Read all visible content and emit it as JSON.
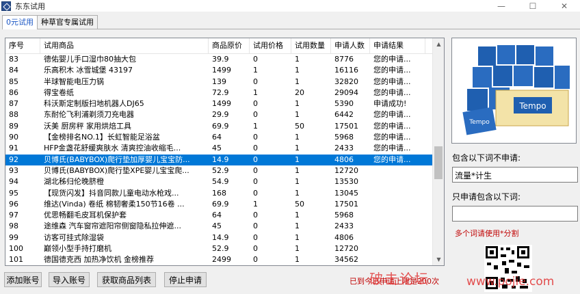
{
  "window": {
    "title": "东东试用",
    "icon": "app-logo-icon"
  },
  "tabs": [
    {
      "label": "0元试用",
      "active": true
    },
    {
      "label": "种草官专属试用",
      "active": false
    }
  ],
  "table": {
    "columns": [
      "序号",
      "试用商品",
      "商品原价",
      "试用价格",
      "试用数量",
      "申请人数",
      "申请结果"
    ],
    "rows": [
      [
        "83",
        "德佑婴儿手口湿巾80抽大包",
        "39.9",
        "0",
        "1",
        "8776",
        "您的申请..."
      ],
      [
        "84",
        "乐高积木 冰雪城堡 43197",
        "1499",
        "1",
        "1",
        "16116",
        "您的申请..."
      ],
      [
        "85",
        "半球智能电压力锅",
        "139",
        "0",
        "1",
        "32820",
        "您的申请..."
      ],
      [
        "86",
        "得宝卷纸",
        "72.9",
        "1",
        "20",
        "29094",
        "您的申请..."
      ],
      [
        "87",
        "科沃斯定制版扫地机器人DJ65",
        "1499",
        "0",
        "1",
        "5390",
        "申请成功!"
      ],
      [
        "88",
        "东耐伦飞利浦剃须刀充电器",
        "29.9",
        "0",
        "1",
        "6442",
        "您的申请..."
      ],
      [
        "89",
        "沃美 厨房秤 家用烘焙工具",
        "69.9",
        "1",
        "50",
        "17501",
        "您的申请..."
      ],
      [
        "90",
        "【金榜排名NO.1】长虹智能足浴盆",
        "64",
        "0",
        "1",
        "5968",
        "您的申请..."
      ],
      [
        "91",
        "HFP金盏花舒缓爽肤水 清爽控油收缩毛...",
        "45",
        "0",
        "1",
        "2433",
        "您的申请..."
      ],
      [
        "92",
        "贝博氏(BABYBOX)爬行垫加厚婴儿宝宝防...",
        "14.9",
        "0",
        "1",
        "4806",
        "您的申请..."
      ],
      [
        "93",
        "贝博氏(BABYBOX)爬行垫XPE婴儿宝宝爬...",
        "52.9",
        "0",
        "1",
        "12720",
        ""
      ],
      [
        "94",
        "湖北秭归伦晚脐橙",
        "54.9",
        "0",
        "1",
        "13530",
        ""
      ],
      [
        "95",
        "【现货闪发】抖音同款儿童电动水枪戏...",
        "168",
        "0",
        "1",
        "13045",
        ""
      ],
      [
        "96",
        "维达(Vinda) 卷纸 棉韧奢柔150节16卷 ...",
        "69.9",
        "1",
        "50",
        "17501",
        ""
      ],
      [
        "97",
        "优思畅翻毛皮耳机保护套",
        "64",
        "0",
        "1",
        "5968",
        ""
      ],
      [
        "98",
        "途维森 汽车窗帘遮阳帘侧窗隐私拉伸遮...",
        "45",
        "0",
        "1",
        "2433",
        ""
      ],
      [
        "99",
        "访客可挂式除湿袋",
        "14.9",
        "0",
        "1",
        "4806",
        ""
      ],
      [
        "100",
        "巅领小型手持打磨机",
        "52.9",
        "0",
        "1",
        "12720",
        ""
      ],
      [
        "101",
        "德国德克西 加热净饮机 金榜推荐",
        "2499",
        "0",
        "1",
        "34562",
        ""
      ]
    ],
    "selected_row_index": 9,
    "overlay_text": "包含"
  },
  "right_panel": {
    "product_image_icon": "tempo-tissue-product-image",
    "exclude_label": "包含以下词不申请:",
    "exclude_value": "流量*计生",
    "include_label": "只申请包含以下词:",
    "include_value": "",
    "hint": "多个词请使用*分割"
  },
  "buttons": {
    "add_account": "添加账号",
    "import_account": "导入账号",
    "fetch_products": "获取商品列表",
    "stop_apply": "停止申请"
  },
  "status_text": "已到今日申请上限是200次",
  "watermark": {
    "text": "破击论坛",
    "url": "www.pojie.com"
  },
  "colors": {
    "selection": "#0078d7",
    "hint_red": "#c00000",
    "active_tab": "#1a56c4"
  }
}
